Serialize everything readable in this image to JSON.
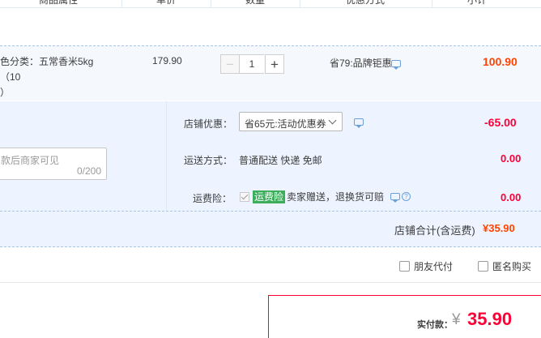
{
  "header": {
    "cols": [
      "商品属性",
      "单价",
      "数量",
      "优惠方式",
      "小计"
    ]
  },
  "item": {
    "attr_line1": "色分类：五常香米5kg（10",
    "attr_line2": "）",
    "unit_price": "179.90",
    "quantity": "1",
    "minus": "−",
    "plus": "+",
    "promo": "省79:品牌钜惠",
    "subtotal": "100.90"
  },
  "message": {
    "placeholder": "款后商家可见",
    "counter": "0/200"
  },
  "shop_discount": {
    "label": "店铺优惠：",
    "selected": "省65元:活动优惠券",
    "amount": "-65.00"
  },
  "shipping": {
    "label": "运送方式：",
    "value": "普通配送 快递 免邮",
    "amount": "0.00"
  },
  "insurance": {
    "label": "运费险：",
    "badge": "运费险",
    "text": "卖家赠送，退换货可赔",
    "help": "?",
    "amount": "0.00"
  },
  "shop_total": {
    "label": "店铺合计(含运费)",
    "value": "¥35.90"
  },
  "options": {
    "friend_pay": "朋友代付",
    "anonymous": "匿名购买"
  },
  "pay": {
    "label": "实付款：",
    "symbol": "¥",
    "value": "35.90"
  },
  "colors": {
    "accent_red": "#ff0036",
    "orange": "#ff4400",
    "badge_green": "#3cae5b",
    "panel_bg": "#eef4ff"
  }
}
